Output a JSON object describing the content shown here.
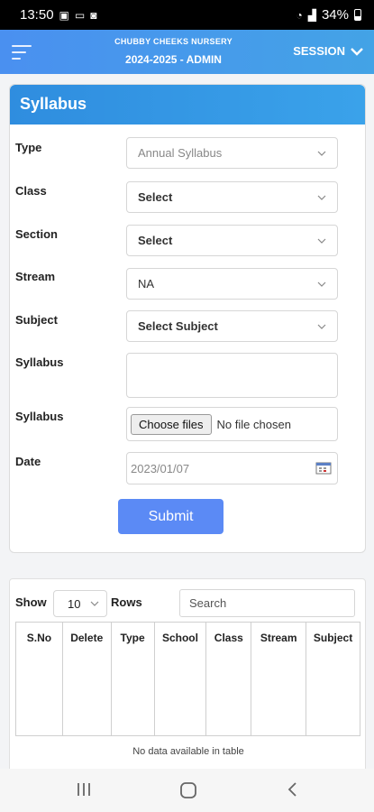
{
  "status": {
    "time": "13:50",
    "battery": "34%"
  },
  "header": {
    "school": "CHUBBY CHEEKS NURSERY",
    "session_year": "2024-2025 - ADMIN",
    "session_label": "SESSION"
  },
  "form": {
    "title": "Syllabus",
    "type_label": "Type",
    "type_value": "Annual Syllabus",
    "class_label": "Class",
    "class_value": "Select",
    "section_label": "Section",
    "section_value": "Select",
    "stream_label": "Stream",
    "stream_value": "NA",
    "subject_label": "Subject",
    "subject_value": "Select Subject",
    "syllabus_label": "Syllabus",
    "file_label": "Syllabus",
    "file_button": "Choose files",
    "file_status": "No file chosen",
    "date_label": "Date",
    "date_value": "2023/01/07",
    "submit": "Submit"
  },
  "table": {
    "show_label": "Show",
    "rows_count": "10",
    "rows_label": "Rows",
    "search_placeholder": "Search",
    "columns": [
      "S.No",
      "Delete",
      "Type",
      "School",
      "Class",
      "Stream",
      "Subject"
    ],
    "empty_message": "No data available in table"
  },
  "colors": {
    "header": "#4a90f0",
    "card_header": "#2f8ddf",
    "submit": "#5b8af5"
  }
}
